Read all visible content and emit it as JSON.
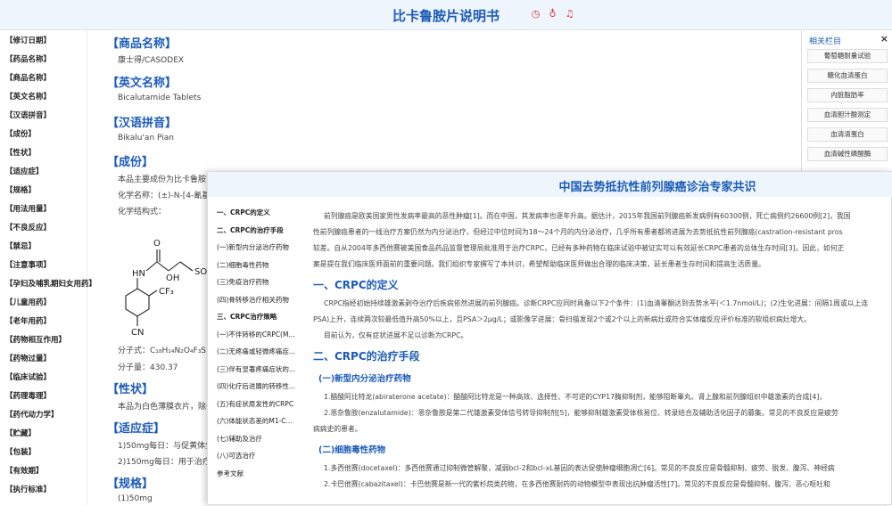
{
  "header": {
    "title": "比卡鲁胺片说明书"
  },
  "header_icons": [
    "clock-icon",
    "user-icon",
    "bell-icon"
  ],
  "nav": [
    "【修订日期】",
    "【药品名称】",
    "【商品名称】",
    "【英文名称】",
    "【汉语拼音】",
    "【成份】",
    "【性状】",
    "【适应症】",
    "【规格】",
    "【用法用量】",
    "【不良反应】",
    "【禁忌】",
    "【注意事项】",
    "【孕妇及哺乳期妇女用药】",
    "【儿童用药】",
    "【老年用药】",
    "【药物相互作用】",
    "【药物过量】",
    "【临床试验】",
    "【药理毒理】",
    "【药代动力学】",
    "【贮藏】",
    "【包装】",
    "【有效期】",
    "【执行标准】"
  ],
  "doc": {
    "s1": "【商品名称】",
    "s1t": "康士得/CASODEX",
    "s2": "【英文名称】",
    "s2t": "Bicalutamide Tablets",
    "s3": "【汉语拼音】",
    "s3t": "Bikalu'an Pian",
    "s4": "【成份】",
    "s4t1": "本品主要成份为比卡鲁胺",
    "s4t2": "化学名称：(±)-N-[4-氰基-",
    "s4t3": "化学结构式：",
    "formula": "分子式：C₁₈H₁₄N₂O₄F₃S",
    "mw": "分子量：430.37",
    "s5": "【性状】",
    "s5t": "本品为白色薄膜衣片，除去",
    "s6": "【适应症】",
    "s6t1": "1)50mg每日：与促黄体生",
    "s6t2": "2)150mg每日：用于治疗",
    "s7": "【规格】",
    "s7t": "(1)50mg"
  },
  "chem": {
    "o1": "O",
    "nh": "HN",
    "oh": "OH",
    "so2": "SO₂",
    "cf3": "CF₃",
    "cn": "CN"
  },
  "related": {
    "title": "相关栏目",
    "close": "×",
    "items": [
      "葡萄糖耐量试验",
      "糖化血清蛋白",
      "内脏脂肪率",
      "血清胆汁酸测定",
      "血清清蛋白",
      "血清碱性磷酸酶"
    ]
  },
  "popup": {
    "title": "中国去势抵抗性前列腺癌诊治专家共识",
    "toc": [
      "一、CRPC的定义",
      "二、CRPC的治疗手段",
      "(一)新型内分泌治疗药物",
      "(二)细胞毒性药物",
      "(三)免疫治疗药物",
      "(四)骨转移治疗相关药物",
      "三、CRPC治疗策略",
      "(一)不伴转移的CRPC(M...",
      "(二)无疼痛或轻微疼痛症...",
      "(三)伴有显著疼痛症状的...",
      "(四)化疗后进展的转移性...",
      "(五)有症状原发性的CRPC",
      "(六)体能状态差的M1-C...",
      "(七)辅助及治疗",
      "(八)可选治疗",
      "参考文献"
    ],
    "p1": "前列腺癌是欧美国家男性发病率最高的恶性肿瘤[1]。而在中国，其发病率也逐年升高。据估计，2015年我国前列腺癌新发病例有60300例，死亡病例约26600例[2]，我国",
    "p2": "较差。自从2004年多西他赛被美国食品药品监督管理局批准用于治疗CRPC，已经有多种药物在临床试验中被证实可以有效延长CRPC患者的总体生存时间[3]。因此，如何正",
    "p3": "案是提在我们临床医师面前的重要问题。我们组织专家撰写了本共识，希望帮助临床医师做出合理的临床决策，延长患者生存时间和提高生活质量。",
    "p0b": "性前列腺癌患者的一线治疗方案仍然为内分泌治疗，但经过中位时间为18～24个月的内分泌治疗，几乎所有患者都将进展为去势抵抗性前列腺癌(castration-resistant pros",
    "h1": "一、CRPC的定义",
    "p4": "CRPC指经初始持续雄激素剥夺治疗后疾病依然进展的前列腺癌。诊断CRPC应同时具备以下2个条件：(1)血清睾酮达到去势水平(＜1.7nmol/L)；(2)生化进展：间隔1周或以上连",
    "p5": "PSA)上升，连续两次较最低值升高50%以上，且PSA＞2μg/L；或影像学进展：骨扫描发现2个或2个以上的新病灶或符合实体瘤反应评价标准的软组织病灶增大。",
    "p6": "目前认为，仅有症状进展不足以诊断为CRPC。",
    "h2": "二、CRPC的治疗手段",
    "h21": "(一)新型内分泌治疗药物",
    "p7": "1.醋酸阿比特龙(abiraterone acetate)：醋酸阿比特龙是一种高效、选择性、不可逆的CYP17酶抑制剂，能够阻断睾丸、肾上腺和前列腺组织中雄激素的合成[4]，",
    "p8": "2.恩杂鲁胺(enzalutamide)：恩杂鲁胺是第二代雄激素受体信号转导抑制剂[5]，能够抑制雄激素受体核易位、转录结合及辅助活化因子的募集。常见的不良反应是疲劳",
    "p9": "病病史的患者。",
    "h22": "(二)细胞毒性药物",
    "p10": "1.多西他赛(docetaxel)：多西他赛通过抑制微管解聚，减弱bcl-2和bcl-xL基因的表达促使肿瘤细胞凋亡[6]。常见的不良反应是骨髓抑制、疲劳、脱发、腹泻、神经病",
    "p11": "2.卡巴他赛(cabazitaxel)：卡巴他赛是新一代的紫杉烷类药物，在多西他赛耐药的动物模型中表现出抗肿瘤活性[7]。常见的不良反应是骨髓抑制、腹泻、恶心呕吐和"
  }
}
